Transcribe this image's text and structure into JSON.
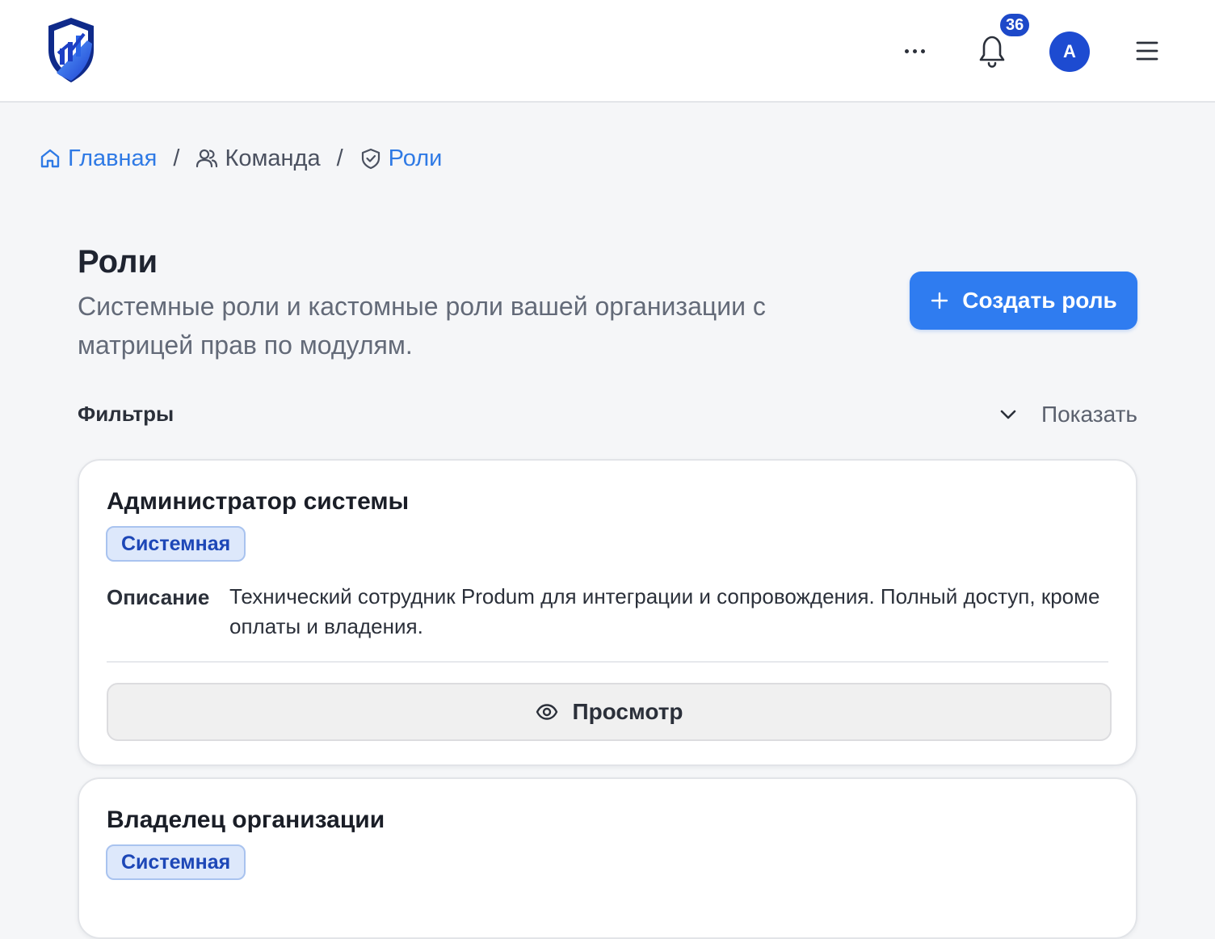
{
  "header": {
    "notifications_count": "36",
    "avatar_initial": "A"
  },
  "breadcrumb": [
    {
      "label": "Главная",
      "icon": "home-icon"
    },
    {
      "label": "Команда",
      "icon": "users-icon"
    },
    {
      "label": "Роли",
      "icon": "shield-check-icon"
    }
  ],
  "page": {
    "title": "Роли",
    "subtitle": "Системные роли и кастомные роли вашей организации с матрицей прав по модулям.",
    "create_button": "Создать роль"
  },
  "filters": {
    "label": "Фильтры",
    "toggle_label": "Показать"
  },
  "roles": [
    {
      "name": "Администратор системы",
      "badge": "Системная",
      "description_label": "Описание",
      "description": "Технический сотрудник Produm для интеграции и сопровождения. Полный доступ, кроме оплаты и владения.",
      "view_button": "Просмотр"
    },
    {
      "name": "Владелец организации",
      "badge": "Системная"
    }
  ],
  "colors": {
    "accent": "#2f7cf0",
    "link": "#2f7ae5",
    "badge_bg": "#dde8fb",
    "badge_text": "#1d47b7",
    "avatar": "#1d4bd1"
  }
}
